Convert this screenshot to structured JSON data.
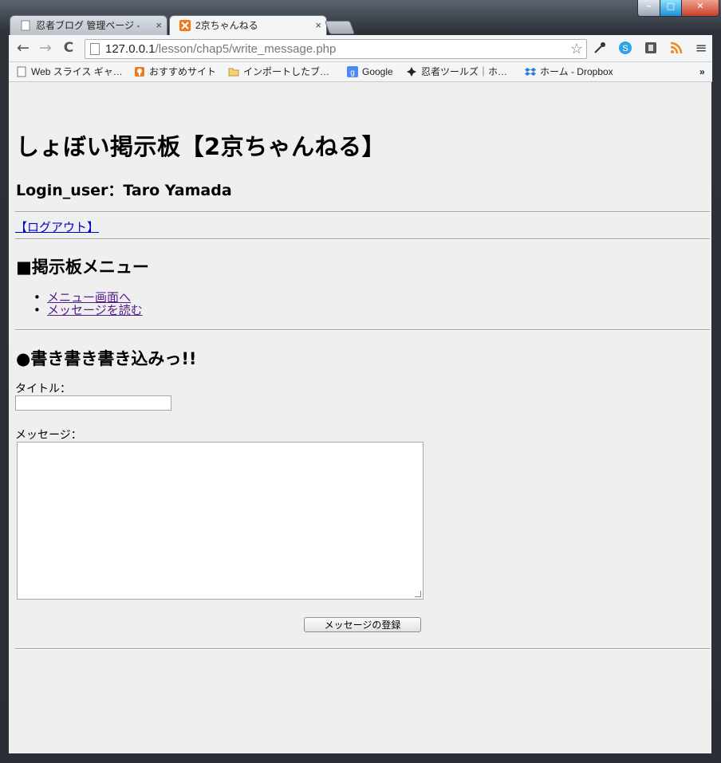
{
  "window": {
    "controls": {
      "minimize": "–",
      "maximize": "□",
      "close": "✕"
    }
  },
  "tabs": [
    {
      "label": "忍者ブログ 管理ページ -",
      "close": "×"
    },
    {
      "label": "2京ちゃんねる",
      "close": "×"
    }
  ],
  "toolbar": {
    "back": "←",
    "forward": "→",
    "reload": "C",
    "url_host": "127.0.0.1",
    "url_path": "/lesson/chap5/write_message.php",
    "star": "☆",
    "menu": "≡"
  },
  "bookmarks": {
    "items": [
      {
        "label": "Web スライス ギャ…",
        "icon": "page-icon"
      },
      {
        "label": "おすすめサイト",
        "icon": "bulb-icon"
      },
      {
        "label": "インポートしたブ…",
        "icon": "folder-icon"
      },
      {
        "label": "Google",
        "icon": "google-icon"
      },
      {
        "label": "忍者ツールズ｜ホ…",
        "icon": "ninja-icon"
      },
      {
        "label": "ホーム - Dropbox",
        "icon": "dropbox-icon"
      }
    ],
    "overflow": "»"
  },
  "page": {
    "title": "しょぼい掲示板【2京ちゃんねる】",
    "login_user": "Login_user：Taro Yamada",
    "logout_link": "【ログアウト】",
    "menu_heading": "■掲示板メニュー",
    "menu_items": [
      "メニュー画面へ",
      "メッセージを読む"
    ],
    "write_heading": "●書き書き書き込みっ!!",
    "title_label": "タイトル：",
    "message_label": "メッセージ：",
    "submit_label": "メッセージの登録"
  }
}
